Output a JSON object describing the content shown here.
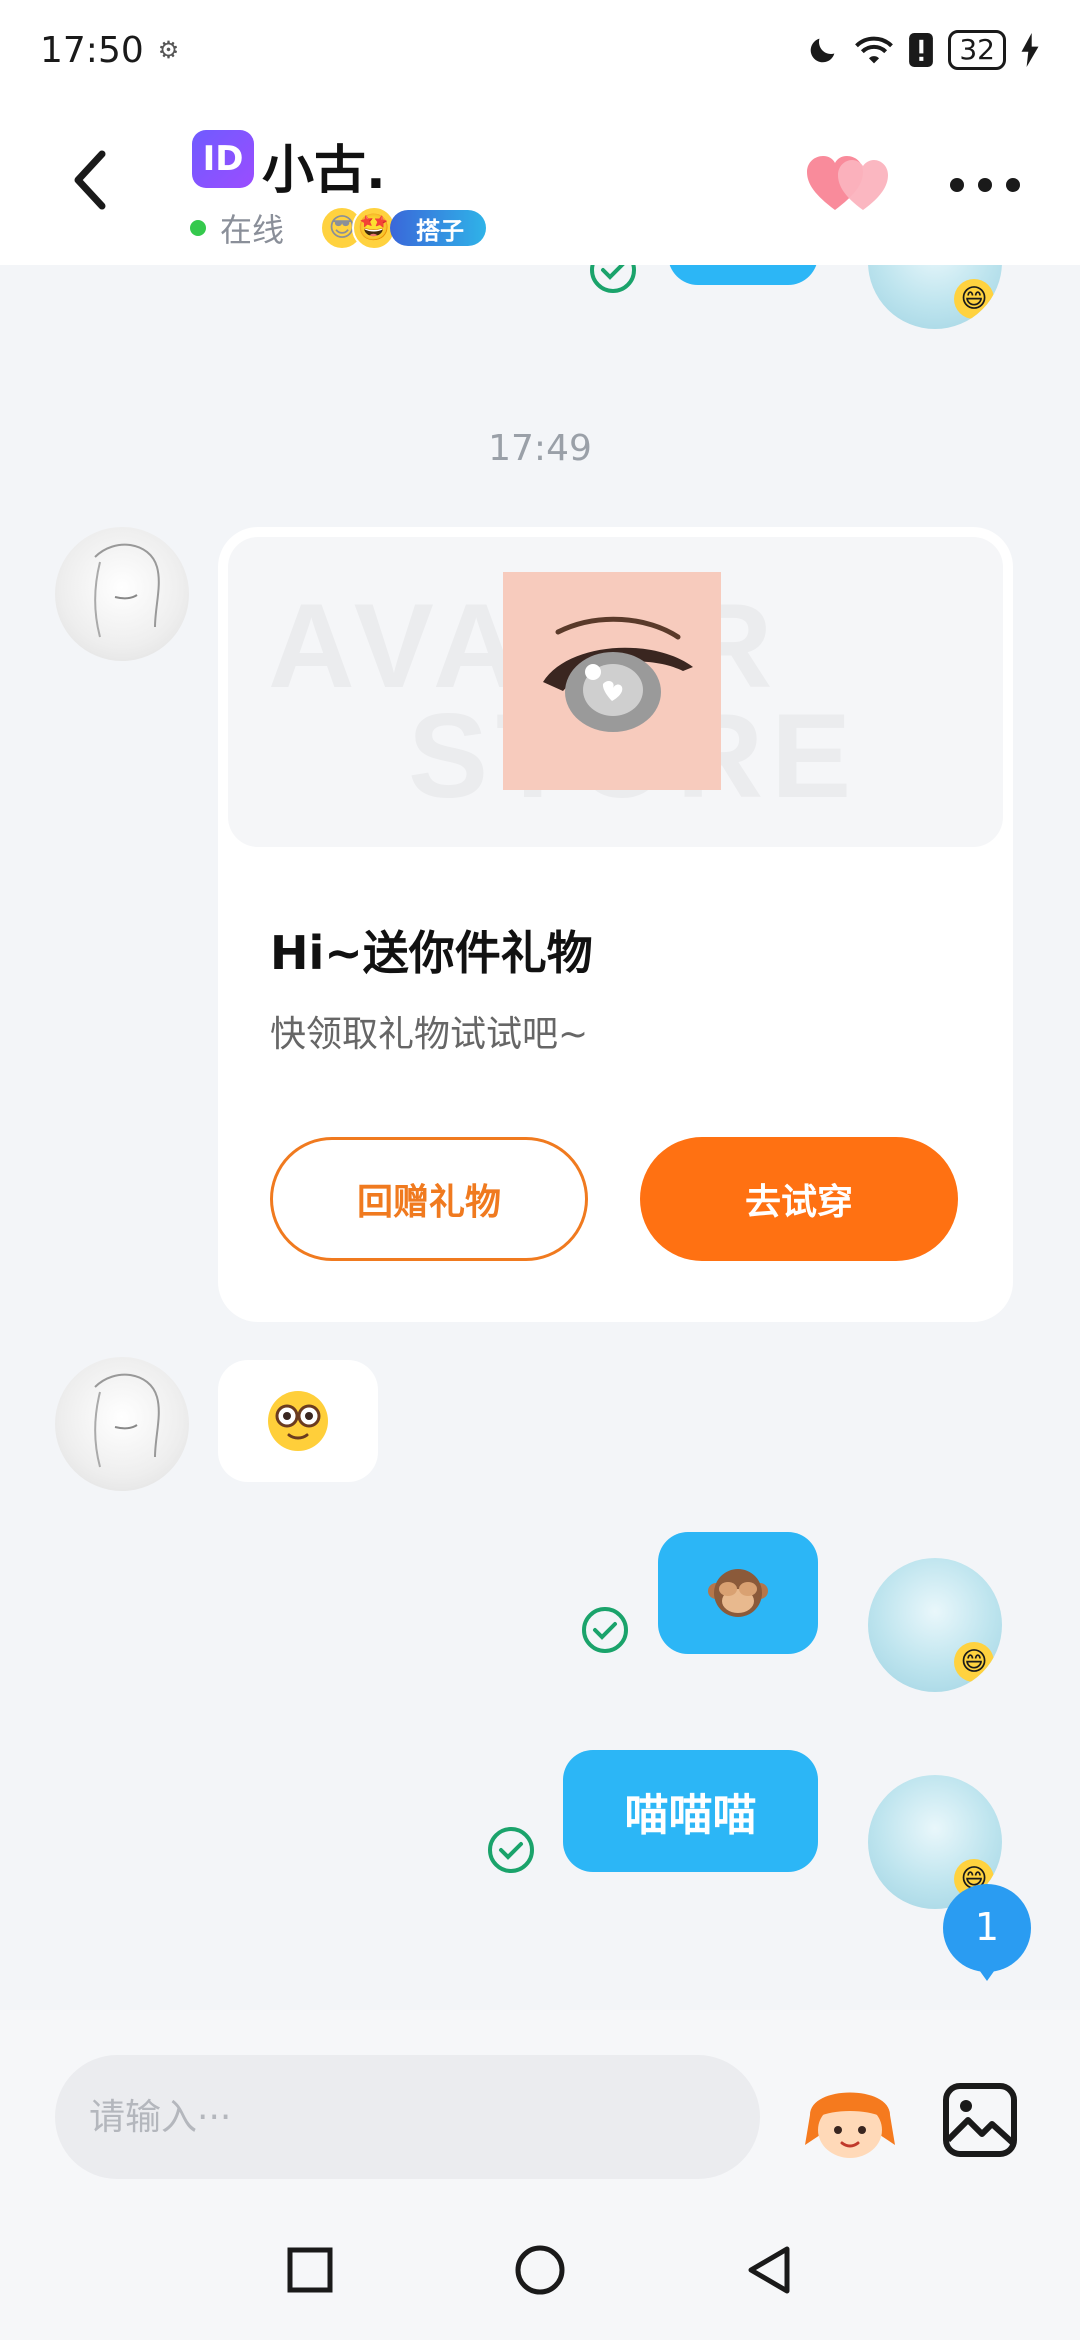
{
  "status_bar": {
    "time": "17:50",
    "battery": "32"
  },
  "header": {
    "id_badge": "ID",
    "name": "小古.",
    "status": "在线",
    "tag": "搭子"
  },
  "chat": {
    "timestamp": "17:49",
    "gift_card": {
      "banner_line1": "AVATAR",
      "banner_line2": "STORE",
      "title": "Hi~送你件礼物",
      "subtitle": "快领取礼物试试吧~",
      "return_gift_label": "回赠礼物",
      "try_on_label": "去试穿"
    },
    "message_text": "喵喵喵",
    "unread_count": "1"
  },
  "input": {
    "placeholder": "请输入···"
  },
  "colors": {
    "accent_orange": "#ff7112",
    "bubble_blue": "#2cb6f6",
    "online_green": "#35c94d",
    "check_green": "#1aa36b"
  }
}
